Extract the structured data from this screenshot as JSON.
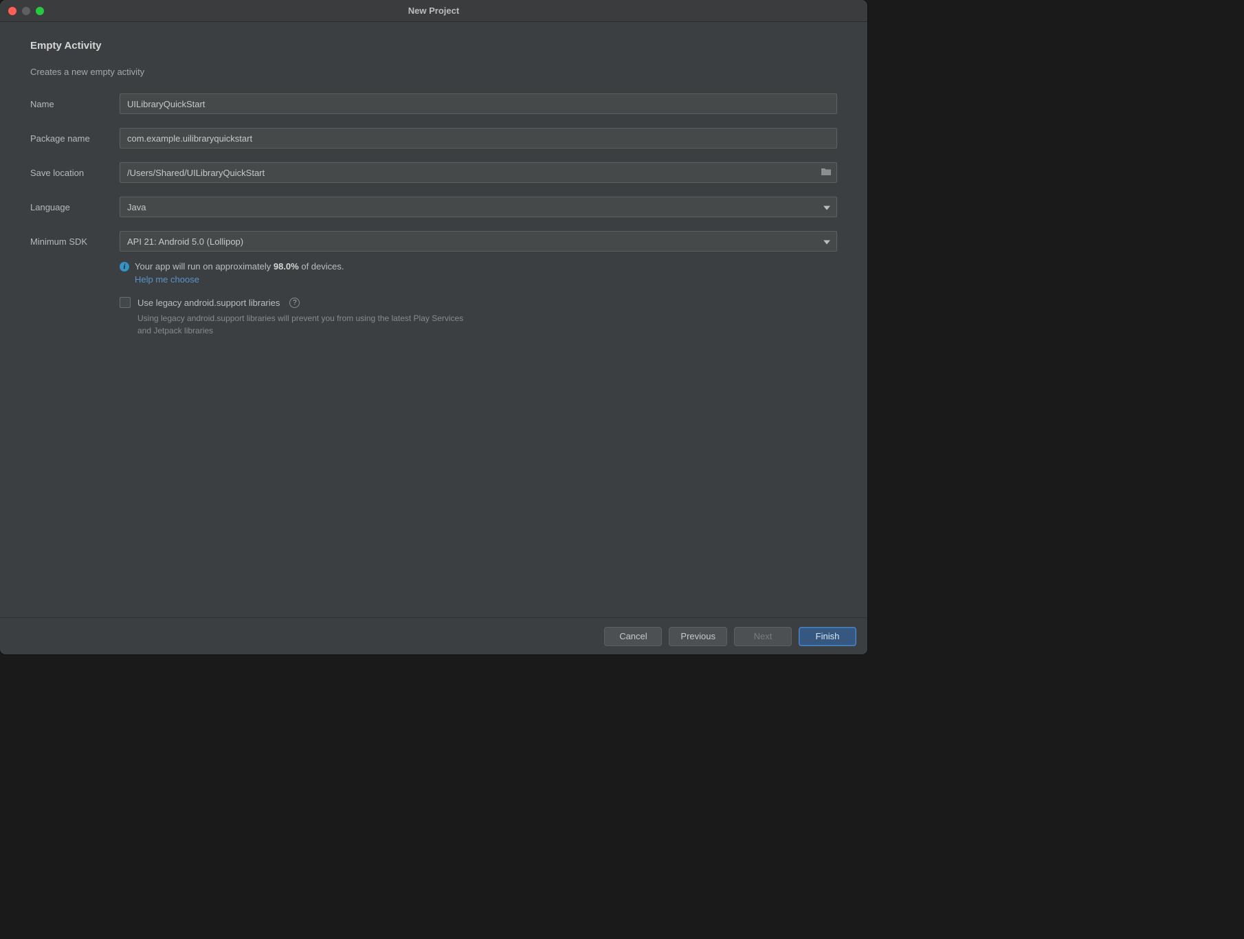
{
  "window": {
    "title": "New Project"
  },
  "page": {
    "heading": "Empty Activity",
    "description": "Creates a new empty activity"
  },
  "form": {
    "name": {
      "label": "Name",
      "value": "UILibraryQuickStart"
    },
    "package": {
      "label": "Package name",
      "value": "com.example.uilibraryquickstart"
    },
    "save_location": {
      "label": "Save location",
      "value": "/Users/Shared/UILibraryQuickStart"
    },
    "language": {
      "label": "Language",
      "value": "Java"
    },
    "min_sdk": {
      "label": "Minimum SDK",
      "value": "API 21: Android 5.0 (Lollipop)"
    }
  },
  "info": {
    "prefix": "Your app will run on approximately ",
    "percent": "98.0%",
    "suffix": " of devices.",
    "help_link": "Help me choose"
  },
  "legacy": {
    "label": "Use legacy android.support libraries",
    "subtext": "Using legacy android.support libraries will prevent you from using the latest Play Services and Jetpack libraries"
  },
  "footer": {
    "cancel": "Cancel",
    "previous": "Previous",
    "next": "Next",
    "finish": "Finish"
  }
}
